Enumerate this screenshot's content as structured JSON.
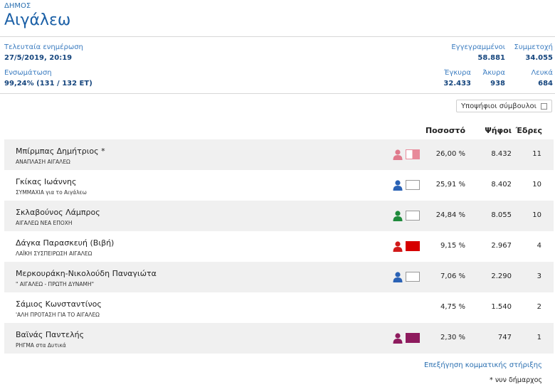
{
  "header": {
    "kicker": "ΔΗΜΟΣ",
    "title": "Αιγάλεω"
  },
  "meta": {
    "last_update_label": "Τελευταία ενημέρωση",
    "last_update_value": "27/5/2019, 20:19",
    "integration_label": "Ενσωμάτωση",
    "integration_value": "99,24% (131 / 132 ΕΤ)",
    "registered_label": "Εγγεγραμμένοι",
    "registered_value": "58.881",
    "turnout_label": "Συμμετοχή",
    "turnout_value": "34.055",
    "valid_label": "Έγκυρα",
    "valid_value": "32.433",
    "invalid_label": "Άκυρα",
    "invalid_value": "938",
    "blank_label": "Λευκά",
    "blank_value": "684"
  },
  "candidates_button": "Υποψήφιοι σύμβουλοι",
  "columns": {
    "pct": "Ποσοστό",
    "votes": "Ψήφοι",
    "seats": "Έδρες"
  },
  "rows": [
    {
      "name": "Μπίρμπας Δημήτριος *",
      "party": "ΑΝΑΠΛΑΣΗ ΑΙΓΑΛΕΩ",
      "pct": "26,00 %",
      "votes": "8.432",
      "seats": "11",
      "person_color": "#e07a8c",
      "swatch_color": "#e88a9a",
      "swatch_split": true
    },
    {
      "name": "Γκίκας Ιωάννης",
      "party": "ΣΥΜΜΑΧΙΑ για το Αιγάλεω",
      "pct": "25,91 %",
      "votes": "8.402",
      "seats": "10",
      "person_color": "#2a62b5",
      "swatch_color": "#ffffff",
      "swatch_split": false
    },
    {
      "name": "Σκλαβούνος Λάμπρος",
      "party": "ΑΙΓΑΛΕΩ ΝΕΑ ΕΠΟΧΗ",
      "pct": "24,84 %",
      "votes": "8.055",
      "seats": "10",
      "person_color": "#1f8a3c",
      "swatch_color": "#ffffff",
      "swatch_split": false
    },
    {
      "name": "Δάγκα Παρασκευή (Βιβή)",
      "party": "ΛΑΪΚΗ ΣΥΣΠΕΙΡΩΣΗ ΑΙΓΑΛΕΩ",
      "pct": "9,15 %",
      "votes": "2.967",
      "seats": "4",
      "person_color": "#d11a1a",
      "swatch_color": "#d60000",
      "swatch_split": false
    },
    {
      "name": "Μερκουράκη-Νικολούδη Παναγιώτα",
      "party": "\" ΑΙΓΑΛΕΩ - ΠΡΩΤΗ ΔΥΝΑΜΗ\"",
      "pct": "7,06 %",
      "votes": "2.290",
      "seats": "3",
      "person_color": "#2a62b5",
      "swatch_color": "#ffffff",
      "swatch_split": false
    },
    {
      "name": "Σάμιος Κωνσταντίνος",
      "party": "'ΑΛΗ ΠΡΟΤΑΣΗ ΓΙΑ ΤΟ ΑΙΓΑΛΕΩ",
      "pct": "4,75 %",
      "votes": "1.540",
      "seats": "2",
      "person_color": "",
      "swatch_color": "",
      "swatch_split": false
    },
    {
      "name": "Βαϊνάς Παντελής",
      "party": "ΡΗΓΜΑ στα Δυτικά",
      "pct": "2,30 %",
      "votes": "747",
      "seats": "1",
      "person_color": "#8e1b5e",
      "swatch_color": "#8e1b5e",
      "swatch_split": false
    }
  ],
  "footer": {
    "explain": "Επεξήγηση κομματικής στήριξης",
    "note": "* νυν δήμαρχος"
  }
}
